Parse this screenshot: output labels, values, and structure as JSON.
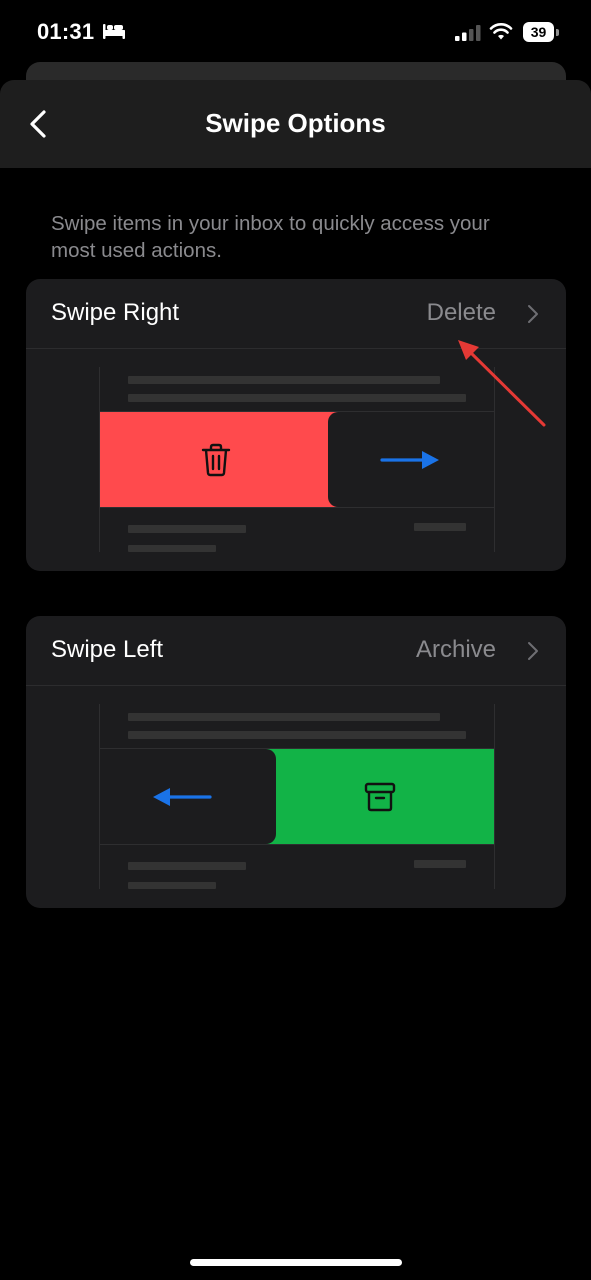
{
  "status_bar": {
    "time": "01:31",
    "battery_level": "39",
    "icons": [
      "bed-icon",
      "signal-icon",
      "wifi-icon",
      "battery-icon"
    ]
  },
  "header": {
    "title": "Swipe Options",
    "back_icon": "chevron-left-icon"
  },
  "description": "Swipe items in your inbox to quickly access your most used actions.",
  "options": [
    {
      "label": "Swipe Right",
      "value": "Delete",
      "action_icon": "trash-icon",
      "direction_icon": "arrow-right-icon",
      "action_color": "#ff4a4d"
    },
    {
      "label": "Swipe Left",
      "value": "Archive",
      "action_icon": "archive-icon",
      "direction_icon": "arrow-left-icon",
      "action_color": "#12b347"
    }
  ],
  "colors": {
    "background": "#000000",
    "card": "#1c1c1e",
    "secondary_text": "#8a8a8e",
    "arrow_blue": "#1a73e8",
    "annotation_red": "#e53935"
  }
}
